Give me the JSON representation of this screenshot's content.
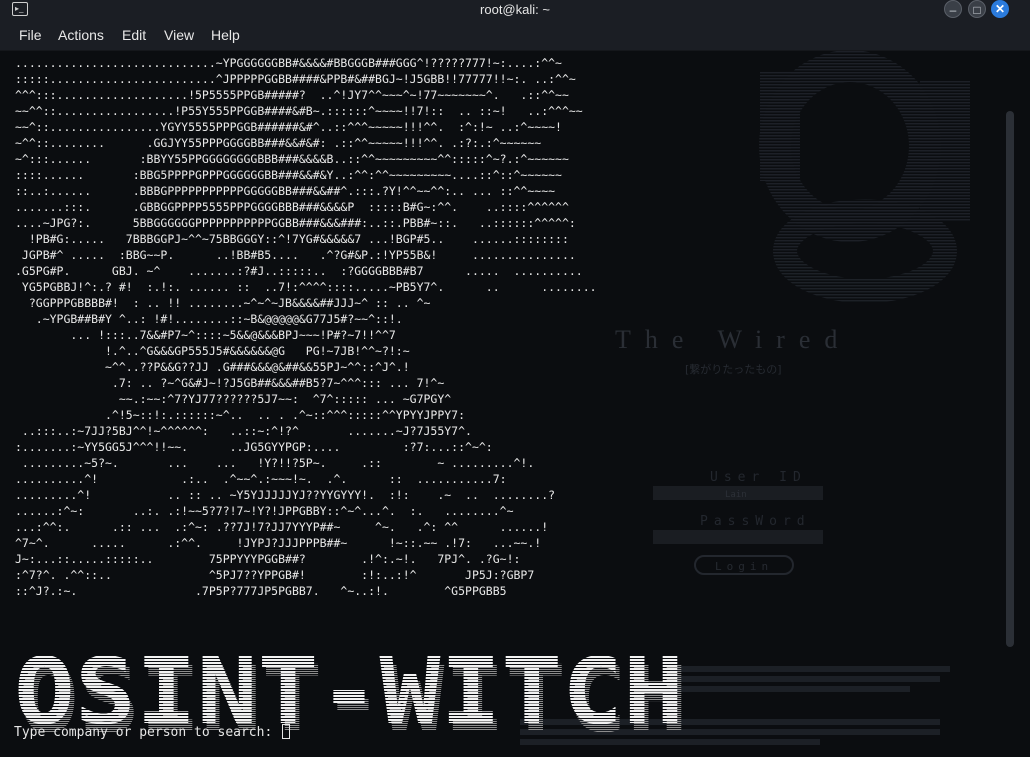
{
  "window": {
    "title": "root@kali: ~",
    "terminal_icon": "terminal-icon",
    "minimize_icon": "minimize-icon",
    "maximize_icon": "maximize-icon",
    "close_icon": "close-icon",
    "close_color": "#2b7bdc"
  },
  "menu": {
    "file": "File",
    "actions": "Actions",
    "edit": "Edit",
    "view": "View",
    "help": "Help"
  },
  "background": {
    "wired_title": "The Wired",
    "wired_subtitle": "[繋がりたったもの]",
    "user_id_label": "User ID",
    "user_id_value": "Lain",
    "password_label": "PassWord",
    "login_label": "Login"
  },
  "terminal": {
    "ascii_art": ".............................~YPGGGGGGBB#&&&&#BBGGGB###GGG^!?????777!~:....:^^~\n:::::........................^JPPPPPGGBB####&PPB#&##BGJ~!J5GBB!!77777!!~:. ..:^^~\n^^^:::...................!5P5555PPGB#####?  ..^!JY7^^~~~^~!77~~~~~~~^.   .::^^~~\n~~^^::.................!P55Y555PPGGB####&#B~.::::::^~~~~!!7!::  .. ::~!   ..:^^^~~\n~~^::................YGYY5555PPPGGB######&#^..::^^^~~~~~!!!^^.  :^:!~ ..:^~~~~!\n~^^::........      .GGJYY55PPPGGGGBB###&&#&#: .::^^~~~~~!!!^^. .:?:.:^~~~~~~\n~^:::......       :BBYY55PPGGGGGGGGBBB###&&&&B..::^^~~~~~~~~~^^:::::^~?.:^~~~~~~\n::::......       :BBG5PPPPGPPPGGGGGGBB###&&#&Y..:^^:^^~~~~~~~~~....::^::^~~~~~~\n::..:......      .BBBGPPPPPPPPPPPGGGGGBB###&&##^.:::.?Y!^^~~^^:.. ... ::^^~~~~\n.......:::.      .GBBGGPPPP5555PPPGGGGBBB###&&&&P  :::::B#G~:^^.    ..::::^^^^^^\n....~JPG?:.      5BBGGGGGGPPPPPPPPPPPGGBB###&&&###:..::.PBB#~::.   ..::::::^^^^^:\n  !PB#G:.....   7BBBGGPJ~^^~75BBGGGY::^!7YG#&&&&&7 ...!BGP#5..    ......::::::::\n JGPB#^ .....  :BBG~~P.      ..!BB#B5....   .^?G#&P.:!YP55B&!     ...............\n.G5PG#P.      GBJ. ~^    .......:?#J..:::::..  :?GGGGBBB#B7      .....  ..........\n YG5PGBBJ!^:.? #!  :.!:. ...... ::  ..7!:^^^^::::.....~PB5Y7^.      ..      ........\n  ?GGPPPGBBBB#!  : .. !! ........~^~^~JB&&&&##JJJ~^ :: .. ^~\n   .~YPGB##B#Y ^..: !#!........::~B&@@@@@&G77J5#?~~^::!.\n        ... !:::..7&&#P7~^::::~5&&@&&&BPJ~~~!P#?~7!!^^7\n             !.^..^G&&&GP555J5#&&&&&&@G   PG!~7JB!^^~?!:~\n             ~^^..??P&&G??JJ .G###&&&@&##&&55PJ~^^::^J^.!\n              .7: .. ?~^G&#J~!?J5GB##&&&##B5?7~^^^::: ... 7!^~\n               ~~.:~~:^7?YJ77??????5J7~~:  ^7^::::: ... ~G7PGY^\n             .^!5~::!:.::::::~^..  .. . .^~::^^^:::::^^YPYYJPPY7:\n ..:::..:~7JJ?5BJ^^!~^^^^^^:   ..::~:^!?^       .......~J?7J55Y7^.\n:.......:~YY5GG5J^^^!!~~.      ..JG5GYYPGP:....         :?7:...::^~^:\n .........~5?~.       ...    ...   !Y?!!?5P~.     .::        ~ .........^!.\n..........^!            .:..  .^~~^.:~~~!~.  .^.      ::  ...........7:\n.........^!           .. :: .. ~Y5YJJJJJYJ??YYGYYY!.  :!:    .~  ..  ........?\n......:^~:       ..:. .:!~~5?7?!7~!Y?!JPPGBBY::^~^...^.  :.   ........^~\n...:^^:.      .:: ...  .:^~: .??7J!7?JJ7YYYP##~     ^~.   .^: ^^      ......!\n^7~^.      .....      .:^^.     !JYPJ?JJJPPPB##~      !~::.~~ .!7:   ...~~.!\nJ~:...::.....:::::..        75PPYYYPGGB##?        .!^:.~!.   7PJ^. .?G~!:\n:^7?^. .^^::..              ^5PJ7??YPPGB#!        :!:..:!^       JP5J:?GBP7\n::^J?.:~.                 .7P5P?777JP5PGBB7.   ^~..:!.        ^G5PPGBB5",
    "banner_text": "OSINT-WITCH",
    "prompt": "Type company or person to search: ",
    "input_value": ""
  }
}
